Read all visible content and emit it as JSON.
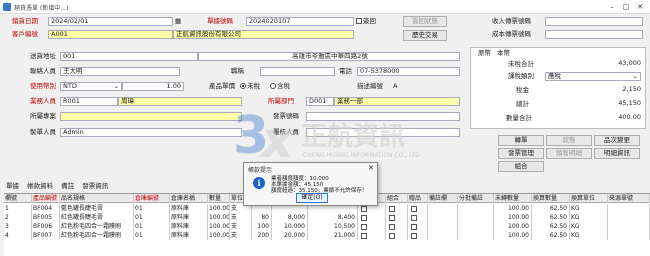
{
  "window": {
    "title": "銷貨憑單 (新增中...)"
  },
  "header": {
    "sale_date_label": "銷貨日期",
    "sale_date": "2024/02/01",
    "cust_no_label": "客戶編號",
    "cust_no": "A001",
    "cust_name": "正航資訊股份有限公司",
    "voucher_no_label": "單據號碼",
    "voucher_no": "2024020107",
    "void_label": "簽回",
    "sign_status_btn": "簽回狀態",
    "history_btn": "歷史交易",
    "receivable_label": "收入傳票號碼",
    "cost_label": "成本傳票號碼"
  },
  "address": {
    "label": "送貨地址",
    "code": "001",
    "text": "高雄市苓雅區中華四路2號"
  },
  "contact": {
    "label": "聯絡人員",
    "value": "王大明",
    "title_label": "職稱",
    "phone_label": "電話",
    "phone": "07-5378000"
  },
  "currency": {
    "label": "使用幣別",
    "value": "NTD",
    "rate": "1.00",
    "price_tax_label": "產品單價",
    "opt_tax_excl": "未稅",
    "opt_tax_incl": "含稅",
    "invoice_label": "描述編號",
    "invoice": "A"
  },
  "sales": {
    "label": "業務人員",
    "code": "R001",
    "name": "周瑋",
    "dept_label": "所屬部門",
    "dept_code": "D001",
    "dept_name": "業務一部"
  },
  "project": {
    "label": "所屬專案",
    "ship_label": "發票號碼"
  },
  "maker": {
    "label": "製單人員",
    "value": "Admin",
    "approver_label": "覆核人員"
  },
  "summary": {
    "orig_label": "原幣",
    "local_label": "本幣",
    "untaxed_label": "未稅合計",
    "untaxed": "43,000",
    "tax_type_label": "課稅類別",
    "tax_type": "應稅",
    "tax_label": "稅金",
    "tax": "2,150",
    "total_label": "總計",
    "total": "45,150",
    "qty_label": "數量合計",
    "qty": "400.00"
  },
  "buttons": {
    "close": "轉單",
    "status": "狀態",
    "change": "品次變更",
    "ship": "發票管理",
    "order": "銷售明細",
    "detail": "明細資訊",
    "combine": "組合"
  },
  "tabs": [
    "單據",
    "帳款資料",
    "備註",
    "發票資訊"
  ],
  "grid": {
    "headers": [
      "欄號",
      "產品編號",
      "品名規格",
      "倉庫編號",
      "倉庫名稱",
      "數量",
      "單位",
      "單價",
      "金額",
      "稅額",
      "附加",
      "組合",
      "贈品",
      "備註欄",
      "分批備註",
      "未轉數量",
      "換算數量",
      "換算單位",
      "來源單號"
    ],
    "rows": [
      [
        "1",
        "BF004",
        "藍色罐長睫毛膏",
        "01",
        "原料庫",
        "100.00",
        "支",
        "",
        "",
        "",
        "",
        "",
        "",
        "",
        "",
        "100.00",
        "62.50",
        "KG",
        ""
      ],
      [
        "2",
        "BF005",
        "紅色罐長睫毛膏",
        "01",
        "原料庫",
        "100.00",
        "支",
        "80",
        "8,000",
        "8,400",
        "",
        "",
        "",
        "",
        "",
        "100.00",
        "62.50",
        "KG",
        ""
      ],
      [
        "3",
        "BF006",
        "紅色粉毛四合一霜膜刷",
        "01",
        "原料庫",
        "100.00",
        "支",
        "100",
        "10,000",
        "10,500",
        "",
        "",
        "",
        "",
        "",
        "100.00",
        "62.50",
        "KG",
        ""
      ],
      [
        "4",
        "BF007",
        "紅色粉毛四合一霜膜刷",
        "01",
        "原料庫",
        "100.00",
        "支",
        "200",
        "20,000",
        "21,000",
        "",
        "",
        "",
        "",
        "",
        "100.00",
        "62.50",
        "KG",
        ""
      ]
    ]
  },
  "dialog": {
    "title": "帳款提示",
    "line1": "業者額度額度：10,000",
    "line2": "本單據金額：45,150",
    "line3": "額度超過：35,150，業績不允許保存！",
    "ok": "確定(O)"
  },
  "watermark": {
    "brand": "正航資訊",
    "sub": "CHENG HUANG INFORMATION CO., LTD"
  },
  "colors": {
    "accent": "#ffffa8",
    "required": "#c00000",
    "dialog_icon": "#1c64c8"
  }
}
